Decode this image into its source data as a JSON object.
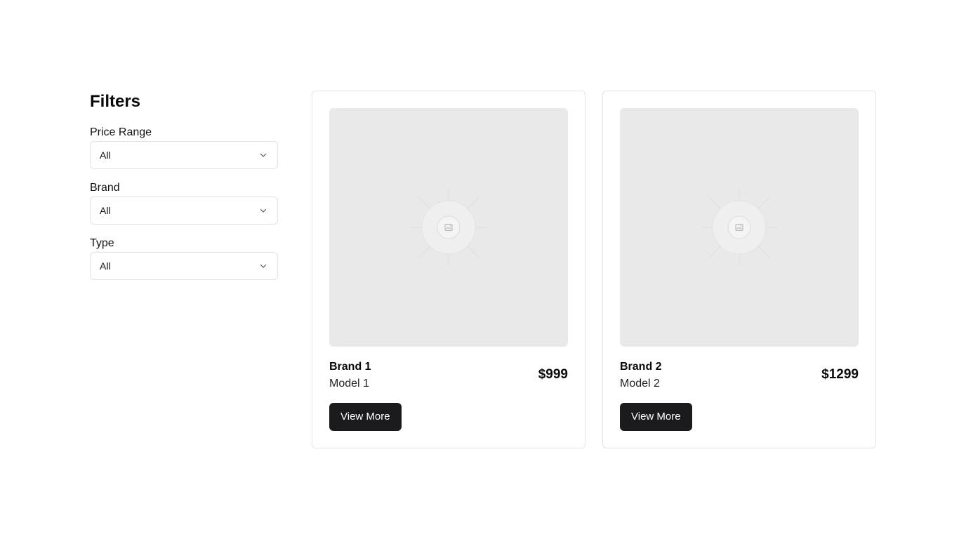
{
  "filters": {
    "title": "Filters",
    "groups": [
      {
        "label": "Price Range",
        "value": "All"
      },
      {
        "label": "Brand",
        "value": "All"
      },
      {
        "label": "Type",
        "value": "All"
      }
    ]
  },
  "products": [
    {
      "brand": "Brand 1",
      "model": "Model 1",
      "price": "$999",
      "button": "View More"
    },
    {
      "brand": "Brand 2",
      "model": "Model 2",
      "price": "$1299",
      "button": "View More"
    }
  ],
  "icons": {
    "select_chevron": "chevron-down-icon",
    "image_placeholder": "image-icon"
  },
  "colors": {
    "button_bg": "#1b1b1d",
    "placeholder_bg": "#e9e9e9",
    "border": "#e2e2e2"
  }
}
